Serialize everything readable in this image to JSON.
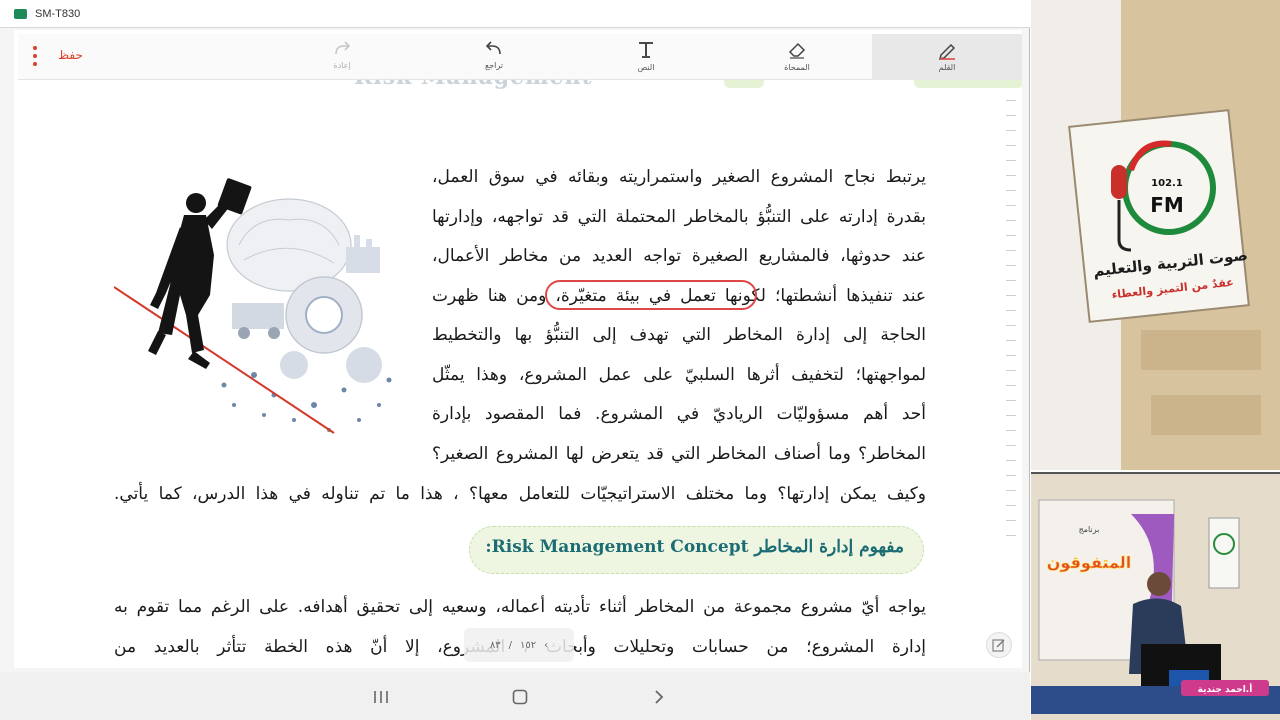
{
  "window": {
    "title": "SM-T830"
  },
  "toolbar": {
    "pen": "القلم",
    "eraser": "الممحاة",
    "text": "النص",
    "undo": "تراجع",
    "redo": "إعادة",
    "save": "حفظ"
  },
  "page": {
    "header_ghost": "Risk Management",
    "intro_lines": [
      "يرتبط نجاح المشروع الصغير واستمراريته وبقائه في سوق العمل،",
      "بقدرة إدارته على التنبُّؤ بالمخاطر المحتملة التي قد تواجهه، وإدارتها",
      "عند حدوثها، فالمشاريع الصغيرة تواجه العديد من مخاطر الأعمال،",
      "عند تنفيذها أنشطتها؛ لكونها تعمل في بيئة متغيّرة، ومن هنا ظهرت",
      "الحاجة إلى إدارة المخاطر التي تهدف إلى التنبُّؤ بها والتخطيط",
      "لمواجهتها؛ لتخفيف أثرها السلبيّ على عمل المشروع، وهذا يمثّل",
      "أحد أهم مسؤوليّات الرياديّ في المشروع. فما المقصود بإدارة",
      "المخاطر؟ وما أصناف المخاطر التي قد يتعرض لها المشروع الصغير؟"
    ],
    "intro_last_line": "وكيف يمكن إدارتها؟ وما مختلف الاستراتيجيّات للتعامل معها؟ ، هذا ما تم تناوله في هذا الدرس، كما يأتي.",
    "section_title": "مفهوم إدارة المخاطر Risk Management Concept:",
    "body_lines": [
      "يواجه أيّ مشروع مجموعة من المخاطر أثناء تأديته أعماله، وسعيه إلى تحقيق أهدافه. على الرغم مما تقوم به",
      "إدارة المشروع؛ من حسابات وتحليلات وأبحاث ، المشروع، إلا أنّ هذه الخطة تتأثر بالعديد من"
    ],
    "pager": {
      "current": "٨٣",
      "total": "١٥٢"
    }
  },
  "studio": {
    "radio_logo_fm": "FM",
    "radio_logo_freq": "102.1",
    "radio_logo_name": "صوت التربية والتعليم",
    "radio_logo_slogan": "عقدٌ من التميز والعطاء",
    "program_label": "برنامج",
    "program_name": "المتفوقون",
    "presenter_name": "أ.احمد جندية"
  },
  "colors": {
    "accent_red": "#d6422a",
    "highlight_oval": "#e04848",
    "section_title": "#1c6c74",
    "section_banner": "#eef6e2"
  }
}
